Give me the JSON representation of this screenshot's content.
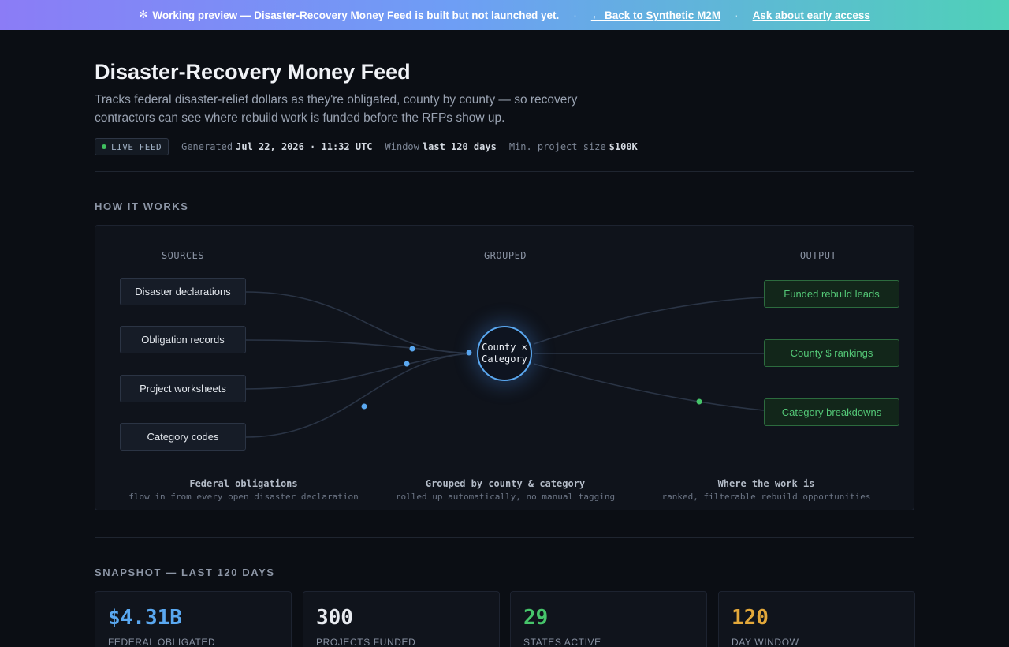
{
  "banner": {
    "message": "Working preview — Disaster-Recovery Money Feed is built but not launched yet.",
    "back_link": "← Back to Synthetic M2M",
    "access_link": "Ask about early access",
    "separator": "·",
    "icon": "gear-icon"
  },
  "header": {
    "title": "Disaster-Recovery Money Feed",
    "subtitle": "Tracks federal disaster-relief dollars as they're obligated, county by county — so recovery contractors can see where rebuild work is funded before the RFPs show up."
  },
  "meta": {
    "live_badge": "LIVE FEED",
    "generated_label": "Generated",
    "generated_value": "Jul 22, 2026 · 11:32 UTC",
    "window_label": "Window",
    "window_value": "last 120 days",
    "min_size_label": "Min. project size",
    "min_size_value": "$100K"
  },
  "how_it_works": {
    "section_title": "HOW IT WORKS",
    "columns": {
      "sources": "SOURCES",
      "grouped": "GROUPED",
      "output": "OUTPUT"
    },
    "sources": [
      "Disaster declarations",
      "Obligation records",
      "Project worksheets",
      "Category codes"
    ],
    "hub": {
      "line1": "County ×",
      "line2": "Category"
    },
    "outputs": [
      "Funded rebuild leads",
      "County $ rankings",
      "Category breakdowns"
    ],
    "captions": [
      {
        "title": "Federal obligations",
        "sub": "flow in from every open disaster declaration"
      },
      {
        "title": "Grouped by county & category",
        "sub": "rolled up automatically, no manual tagging"
      },
      {
        "title": "Where the work is",
        "sub": "ranked, filterable rebuild opportunities"
      }
    ]
  },
  "snapshot": {
    "section_title": "SNAPSHOT — LAST 120 DAYS",
    "stats": [
      {
        "value": "$4.31B",
        "label": "FEDERAL OBLIGATED",
        "color": "#5aa8f0"
      },
      {
        "value": "300",
        "label": "PROJECTS FUNDED",
        "color": "#e8ebf0"
      },
      {
        "value": "29",
        "label": "STATES ACTIVE",
        "color": "#46c46a"
      },
      {
        "value": "120",
        "label": "DAY WINDOW",
        "color": "#e3a83a"
      }
    ]
  },
  "colors": {
    "source_accent": "#5aa8f0",
    "output_accent": "#46c46a",
    "background": "#0b0e14"
  }
}
